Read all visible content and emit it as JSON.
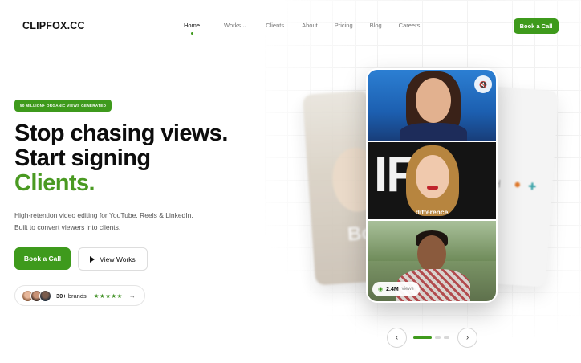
{
  "nav": {
    "logo": "CLIPFOX.CC",
    "links": [
      "Home",
      "Works",
      "Clients",
      "About",
      "Pricing",
      "Blog",
      "Careers"
    ],
    "active_index": 0,
    "cta": "Book a Call"
  },
  "hero": {
    "badge": "50 MILLION+ ORGANIC VIEWS GENERATED",
    "headline_line1": "Stop chasing views.",
    "headline_line2": "Start signing",
    "headline_line3": "Clients.",
    "subtext_line1": "High-retention video editing for YouTube, Reels & LinkedIn.",
    "subtext_line2": "Built to convert viewers into clients.",
    "primary_button": "Book a Call",
    "secondary_button": "View Works",
    "social_count": "30+",
    "social_label": "brands",
    "stars": "★★★★★"
  },
  "showcase": {
    "caption": "difference",
    "views_count": "2.4M",
    "views_label": "views"
  },
  "carousel": {
    "active_index": 0,
    "total": 3
  },
  "colors": {
    "accent": "#3e9a1c",
    "headline_green": "#4a9a22",
    "text_dark": "#0d0d0d",
    "text_muted": "#555555"
  },
  "icons": [
    "chevron-down-icon",
    "play-icon",
    "star-icon",
    "arrow-right-icon",
    "mute-icon",
    "eye-icon",
    "chevron-left-icon",
    "chevron-right-icon"
  ]
}
